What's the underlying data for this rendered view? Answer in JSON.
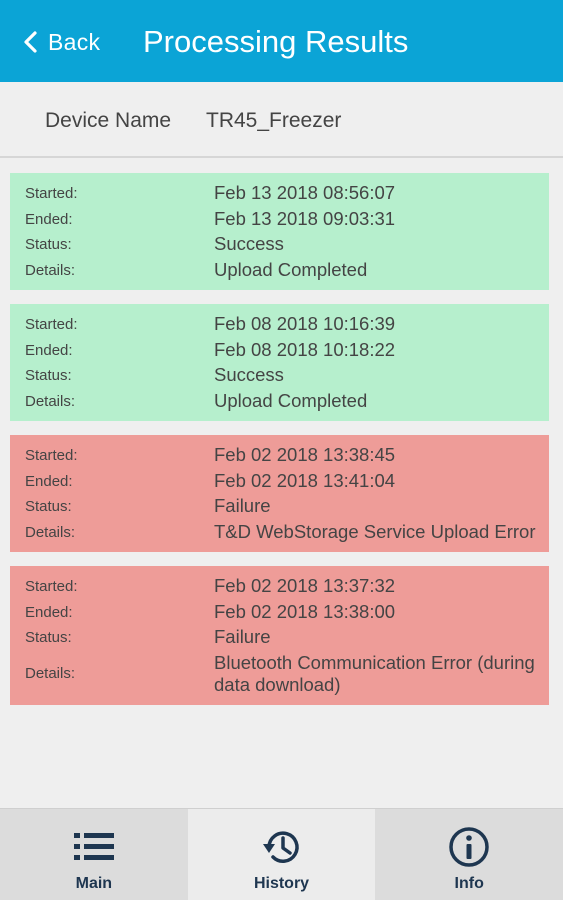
{
  "header": {
    "back_label": "Back",
    "title": "Processing Results",
    "color": "#0ba4d6"
  },
  "device": {
    "label": "Device Name",
    "value": "TR45_Freezer"
  },
  "labels": {
    "started": "Started:",
    "ended": "Ended:",
    "status": "Status:",
    "details": "Details:"
  },
  "results": [
    {
      "started": "Feb 13 2018 08:56:07",
      "ended": "Feb 13 2018 09:03:31",
      "status": "Success",
      "details": "Upload Completed",
      "color": "#b6efcd"
    },
    {
      "started": "Feb 08 2018 10:16:39",
      "ended": "Feb 08 2018 10:18:22",
      "status": "Success",
      "details": "Upload Completed",
      "color": "#b6efcd"
    },
    {
      "started": "Feb 02 2018 13:38:45",
      "ended": "Feb 02 2018 13:41:04",
      "status": "Failure",
      "details": "T&D WebStorage Service Upload Error",
      "color": "#ee9c98"
    },
    {
      "started": "Feb 02 2018 13:37:32",
      "ended": "Feb 02 2018 13:38:00",
      "status": "Failure",
      "details": "Bluetooth Communication Error (during data download)",
      "color": "#ee9c98"
    }
  ],
  "nav": {
    "main": {
      "label": "Main",
      "icon": "list-icon"
    },
    "history": {
      "label": "History",
      "icon": "history-icon",
      "active": true
    },
    "info": {
      "label": "Info",
      "icon": "info-icon"
    }
  }
}
